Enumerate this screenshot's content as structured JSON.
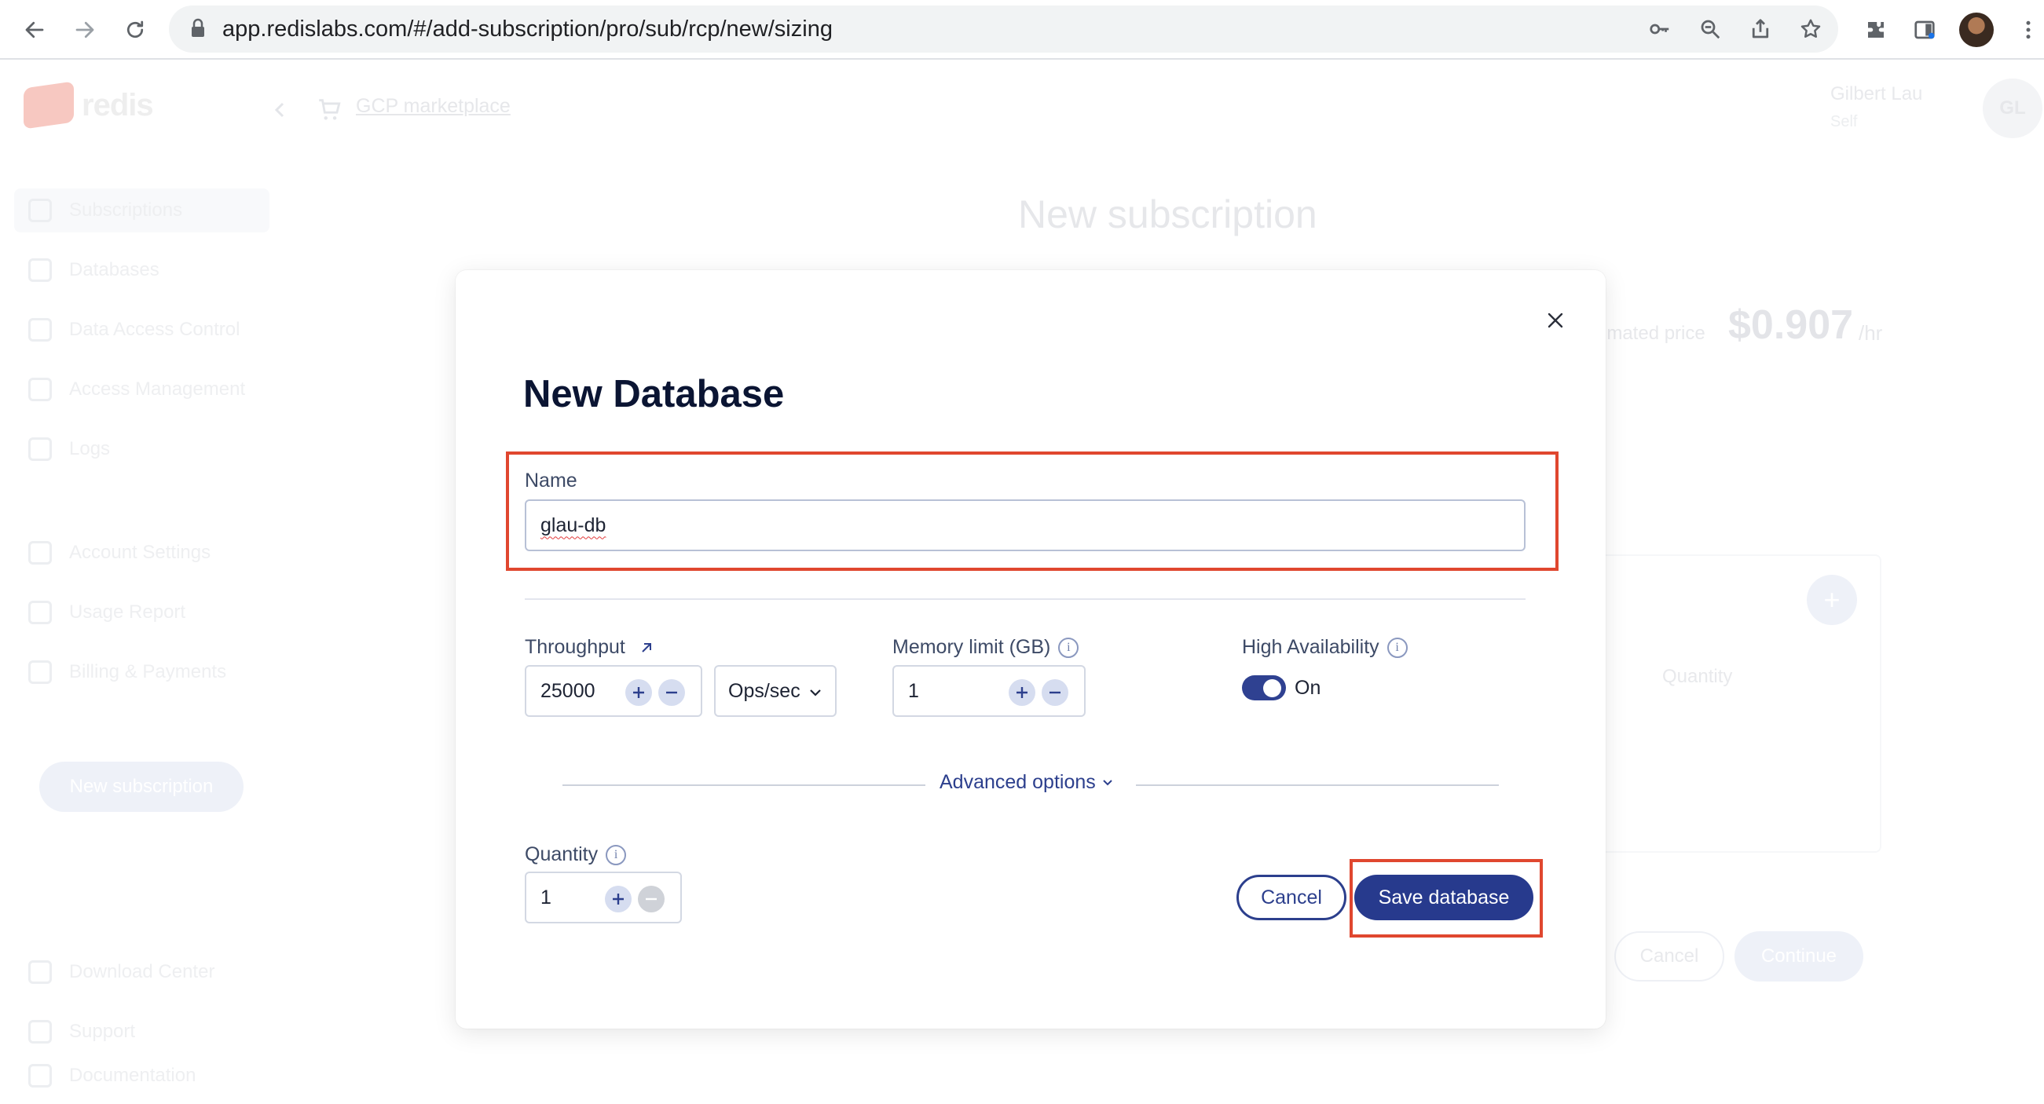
{
  "browser": {
    "url": "app.redislabs.com/#/add-subscription/pro/sub/rcp/new/sizing"
  },
  "app": {
    "logo_text": "redis",
    "marketplace_link": "GCP marketplace",
    "user_name": "Gilbert Lau",
    "user_role": "Self",
    "user_initials": "GL",
    "sidebar": {
      "items": [
        {
          "label": "Subscriptions",
          "icon": "layers-icon"
        },
        {
          "label": "Databases",
          "icon": "database-icon"
        },
        {
          "label": "Data Access Control",
          "icon": "key-icon"
        },
        {
          "label": "Access Management",
          "icon": "user-icon"
        },
        {
          "label": "Logs",
          "icon": "calendar-icon"
        },
        {
          "label": "Account Settings",
          "icon": "gear-icon"
        },
        {
          "label": "Usage Report",
          "icon": "report-icon"
        },
        {
          "label": "Billing & Payments",
          "icon": "card-icon"
        },
        {
          "label": "Download Center",
          "icon": "download-icon"
        },
        {
          "label": "Support",
          "icon": "support-icon"
        },
        {
          "label": "Documentation",
          "icon": "docs-icon"
        }
      ],
      "new_subscription": "New subscription"
    },
    "page_title": "New subscription",
    "price_label": "imated price",
    "price_value": "$0.907",
    "price_unit": "/hr",
    "card_qty_label": "Quantity",
    "cancel": "Cancel",
    "continue": "Continue"
  },
  "modal": {
    "title": "New Database",
    "name_label": "Name",
    "name_value": "glau-db",
    "throughput_label": "Throughput",
    "throughput_value": "25000",
    "throughput_unit": "Ops/sec",
    "memory_label": "Memory limit (GB)",
    "memory_value": "1",
    "ha_label": "High Availability",
    "ha_state": "On",
    "advanced_options": "Advanced options",
    "quantity_label": "Quantity",
    "quantity_value": "1",
    "cancel": "Cancel",
    "save": "Save database",
    "highlight_color": "#e0472f",
    "accent_color": "#273a8d"
  }
}
